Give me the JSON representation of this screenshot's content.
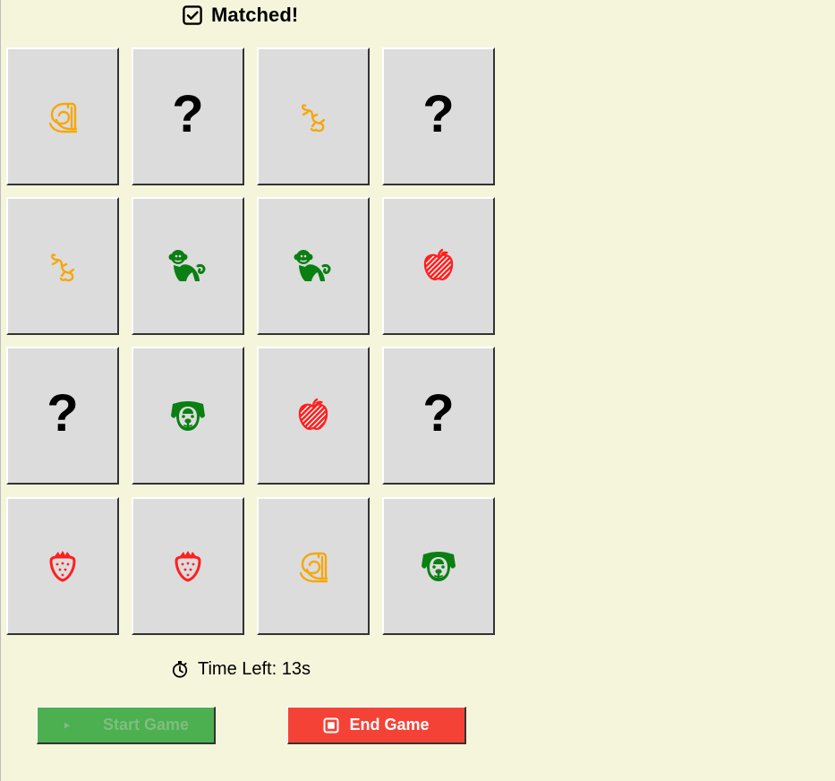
{
  "status": {
    "text": "Matched!",
    "icon": "checkbox-checked-icon"
  },
  "grid": {
    "rows": 4,
    "columns": 4,
    "cards": [
      {
        "state": "revealed",
        "icon": "snake-icon",
        "color": "#f6a70a"
      },
      {
        "state": "hidden",
        "label": "?"
      },
      {
        "state": "revealed",
        "icon": "lizard-icon",
        "color": "#f6a70a"
      },
      {
        "state": "hidden",
        "label": "?"
      },
      {
        "state": "revealed",
        "icon": "lizard-icon",
        "color": "#f6a70a"
      },
      {
        "state": "revealed",
        "icon": "monkey-icon",
        "color": "#0a7f12"
      },
      {
        "state": "revealed",
        "icon": "monkey-icon",
        "color": "#0a7f12"
      },
      {
        "state": "revealed",
        "icon": "apple-icon",
        "color": "#ff1f1f"
      },
      {
        "state": "hidden",
        "label": "?"
      },
      {
        "state": "revealed",
        "icon": "dog-icon",
        "color": "#0a7f12"
      },
      {
        "state": "revealed",
        "icon": "apple-icon",
        "color": "#ff1f1f"
      },
      {
        "state": "hidden",
        "label": "?"
      },
      {
        "state": "revealed",
        "icon": "strawberry-icon",
        "color": "#ff1f1f"
      },
      {
        "state": "revealed",
        "icon": "strawberry-icon",
        "color": "#ff1f1f"
      },
      {
        "state": "revealed",
        "icon": "snake-icon",
        "color": "#f6a70a"
      },
      {
        "state": "revealed",
        "icon": "dog-icon",
        "color": "#0a7f12"
      }
    ]
  },
  "timer": {
    "text": "Time Left: 13s",
    "icon": "stopwatch-icon"
  },
  "controls": {
    "start_label": "Start Game",
    "start_icon": "play-icon",
    "start_state": "disabled",
    "end_label": "End Game",
    "end_icon": "stop-icon"
  },
  "colors": {
    "background": "#f5f5dc",
    "card": "#dcdcdc",
    "start_button": "#4caf50",
    "end_button": "#f44336"
  }
}
